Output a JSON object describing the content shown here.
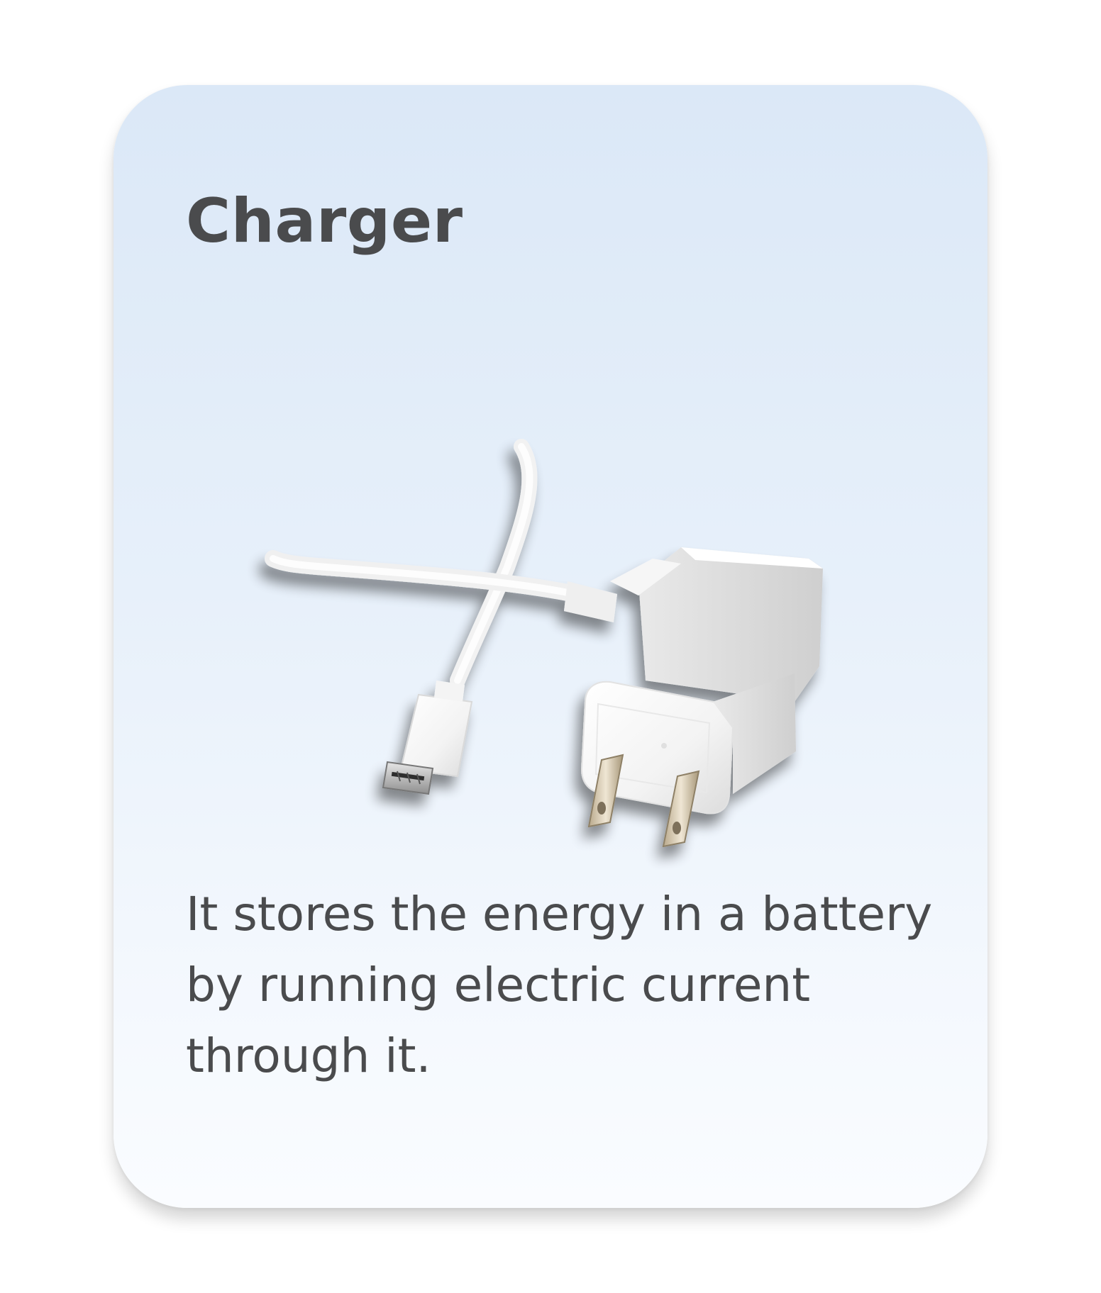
{
  "card": {
    "title": "Charger",
    "image_subject": "charger-illustration",
    "description": "It stores the energy in a battery by running electric current through it."
  },
  "colors": {
    "text": "#4a4b4d",
    "card_gradient_top": "#dbe8f7",
    "card_gradient_bottom": "#fafcff"
  }
}
